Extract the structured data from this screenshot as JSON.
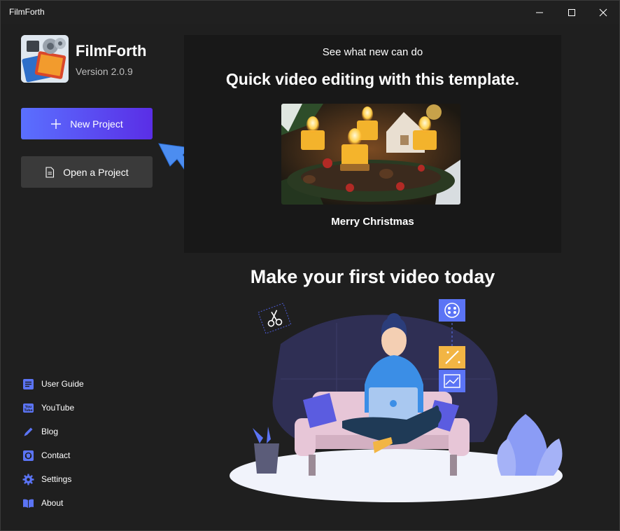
{
  "window": {
    "title": "FilmForth",
    "controls": [
      "minimize-icon",
      "maximize-icon",
      "close-icon"
    ]
  },
  "sidebar": {
    "app_name": "FilmForth",
    "version": "Version  2.0.9",
    "new_project_label": "New Project",
    "open_project_label": "Open a Project",
    "links": [
      {
        "label": "User Guide",
        "icon": "user-guide-icon"
      },
      {
        "label": "YouTube",
        "icon": "youtube-icon"
      },
      {
        "label": "Blog",
        "icon": "blog-pencil-icon"
      },
      {
        "label": "Contact",
        "icon": "contact-icon"
      },
      {
        "label": "Settings",
        "icon": "gear-icon"
      },
      {
        "label": "About",
        "icon": "book-icon"
      }
    ]
  },
  "template_panel": {
    "subtitle": "See what new can do",
    "headline": "Quick video editing with this template.",
    "template_caption": "Merry Christmas"
  },
  "main": {
    "headline": "Make your first video today"
  },
  "colors": {
    "accent_start": "#5a70ff",
    "accent_end": "#5a2ee6",
    "background": "#1f1f1f",
    "panel": "#181818",
    "arrow": "#4c8df0"
  }
}
